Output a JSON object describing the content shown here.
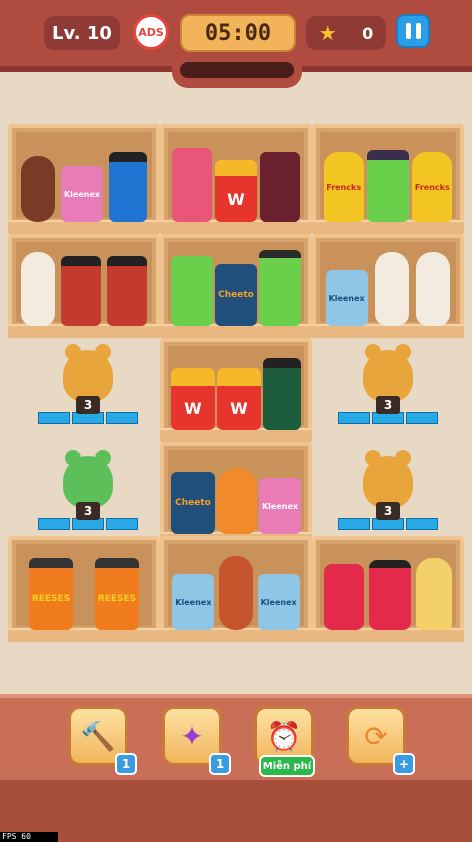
{
  "header": {
    "level": "Lv. 10",
    "ads_label": "ADS",
    "timer": "05:00",
    "star_count": "0",
    "progress": 0
  },
  "boosters": [
    {
      "name": "hammer",
      "count": "1"
    },
    {
      "name": "magic-wand",
      "count": "1"
    },
    {
      "name": "alarm-clock",
      "free_label": "Miễn phí"
    },
    {
      "name": "shuffle",
      "count": "+"
    }
  ],
  "locked_slots": [
    {
      "count": "3",
      "bear_color": "#e8a53c"
    },
    {
      "count": "3",
      "bear_color": "#e8a53c"
    },
    {
      "count": "3",
      "bear_color": "#5cbf5a"
    },
    {
      "count": "3",
      "bear_color": "#e8a53c"
    }
  ],
  "item_labels": {
    "kleenex": "Kleenex",
    "frenchs": "Frencks",
    "cheetos": "Cheeto",
    "reeses": "REESES",
    "fries": "W"
  },
  "fps": "FPS 60"
}
